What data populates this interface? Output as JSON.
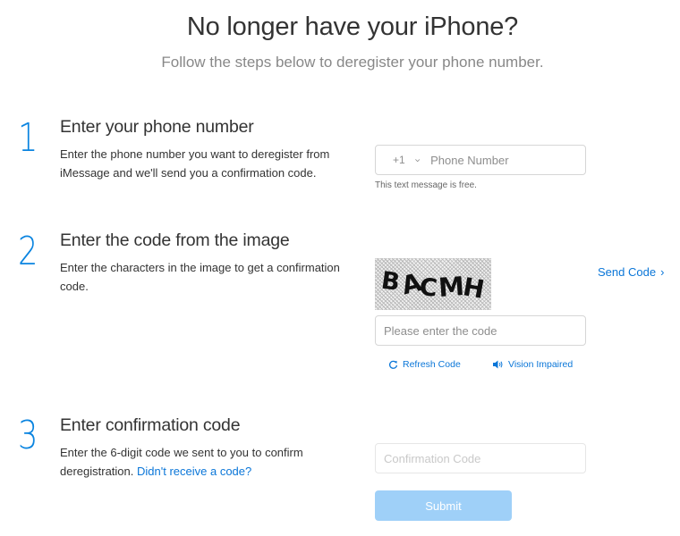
{
  "header": {
    "title": "No longer have your iPhone?",
    "subtitle": "Follow the steps below to deregister your phone number."
  },
  "colors": {
    "accent": "#0a84e0",
    "link": "#0a76d8",
    "submit_disabled": "#9fd0f8"
  },
  "steps": [
    {
      "number": "1",
      "title": "Enter your phone number",
      "description": "Enter the phone number you want to deregister from iMessage and we'll send you a confirmation code."
    },
    {
      "number": "2",
      "title": "Enter the code from the image",
      "description": "Enter the characters in the image to get a confirmation code."
    },
    {
      "number": "3",
      "title": "Enter confirmation code",
      "description": "Enter the 6-digit code we sent to you to confirm deregistration.",
      "link_text": "Didn't receive a code?"
    }
  ],
  "phone": {
    "country_code": "+1",
    "placeholder": "Phone Number",
    "value": "",
    "note": "This text message is free."
  },
  "captcha": {
    "image_text": "BACMH",
    "placeholder": "Please enter the code",
    "value": "",
    "send_code_label": "Send Code",
    "refresh_label": "Refresh Code",
    "vision_label": "Vision Impaired"
  },
  "confirmation": {
    "placeholder": "Confirmation Code",
    "value": "",
    "submit_label": "Submit"
  }
}
